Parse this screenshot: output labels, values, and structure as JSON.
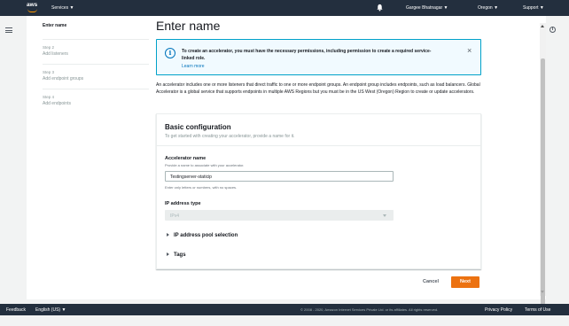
{
  "topnav": {
    "logo": "aws",
    "services": "Services ▼",
    "user": "Gargee Bhatnagar ▼",
    "region": "Oregon ▼",
    "support": "Support ▼"
  },
  "steps": {
    "current": "Enter name",
    "items": [
      {
        "num": "Step 2",
        "label": "Add listeners"
      },
      {
        "num": "Step 3",
        "label": "Add endpoint groups"
      },
      {
        "num": "Step 4",
        "label": "Add endpoints"
      }
    ]
  },
  "page_title": "Enter name",
  "alert": {
    "text": "To create an accelerator, you must have the necessary permissions, including permission to create a required service-linked role.",
    "link": "Learn more",
    "icon": "info-icon",
    "close": "×"
  },
  "intro": "An accelerator includes one or more listeners that direct traffic to one or more endpoint groups. An endpoint group includes endpoints, such as load balancers. Global Accelerator is a global service that supports endpoints in multiple AWS Regions but you must be in the US West (Oregon) Region to create or update accelerators.",
  "panel": {
    "title": "Basic configuration",
    "subtitle": "To get started with creating your accelerator, provide a name for it.",
    "name_label": "Accelerator name",
    "name_desc": "Provide a name to associate with your accelerator.",
    "name_value": "Testingserver-staticip",
    "name_hint": "Enter only letters or numbers, with no spaces.",
    "ip_label": "IP address type",
    "ip_value": "IPv4",
    "pool_label": "IP address pool selection",
    "tags_label": "Tags"
  },
  "buttons": {
    "cancel": "Cancel",
    "next": "Next"
  },
  "footer": {
    "feedback": "Feedback",
    "language": "English (US) ▼",
    "copyright": "© 2008 - 2020, Amazon Internet Services Private Ltd. or its affiliates. All rights reserved.",
    "privacy": "Privacy Policy",
    "terms": "Terms of Use"
  },
  "colors": {
    "nav": "#232f3e",
    "accent": "#ec7211",
    "info": "#0073bb",
    "brand_smile": "#ff9900"
  }
}
